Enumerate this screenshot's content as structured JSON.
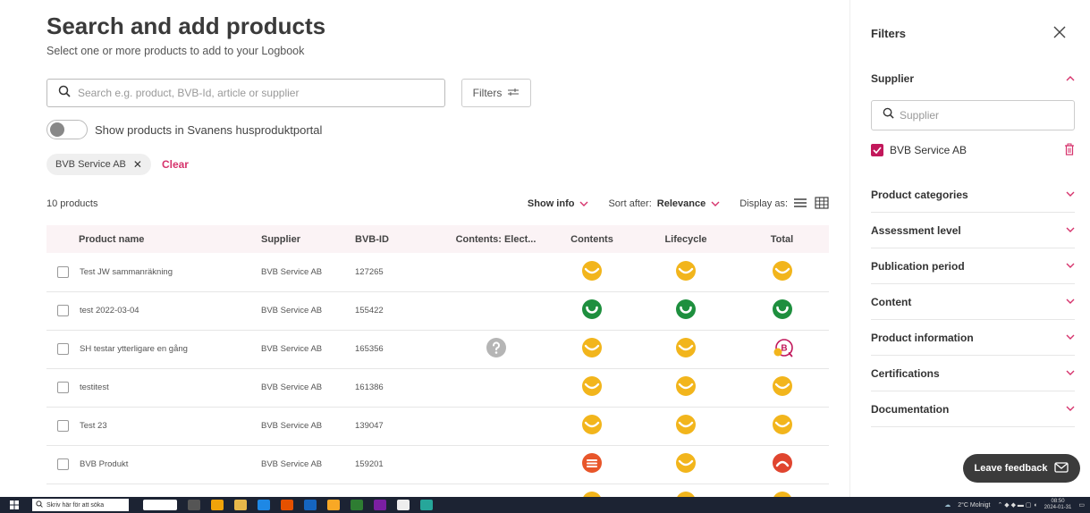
{
  "header": {
    "title": "Search and add products",
    "subtitle": "Select one or more products to add to your Logbook"
  },
  "search": {
    "placeholder": "Search e.g. product, BVB-Id, article or supplier",
    "value": ""
  },
  "filters_button": {
    "label": "Filters"
  },
  "toggle": {
    "label": "Show products in Svanens husproduktportal",
    "on": false
  },
  "chips": [
    {
      "label": "BVB Service AB"
    }
  ],
  "clear_label": "Clear",
  "list_header": {
    "count": "10 products",
    "show_info": "Show info",
    "sort_prefix": "Sort after:",
    "sort_value": "Relevance",
    "display_as": "Display as:"
  },
  "table": {
    "columns": [
      "Product name",
      "Supplier",
      "BVB-ID",
      "Contents: Elect...",
      "Contents",
      "Lifecycle",
      "Total"
    ],
    "rows": [
      {
        "name": "Test JW sammanräkning",
        "supplier": "BVB Service AB",
        "id": "127265",
        "elec": "",
        "contents": "yellow",
        "lifecycle": "yellow",
        "total": "yellow"
      },
      {
        "name": "test 2022-03-04",
        "supplier": "BVB Service AB",
        "id": "155422",
        "elec": "",
        "contents": "green",
        "lifecycle": "green",
        "total": "green"
      },
      {
        "name": "SH testar ytterligare en gång",
        "supplier": "BVB Service AB",
        "id": "165356",
        "elec": "question",
        "contents": "yellow",
        "lifecycle": "yellow",
        "total": "bq"
      },
      {
        "name": "testitest",
        "supplier": "BVB Service AB",
        "id": "161386",
        "elec": "",
        "contents": "yellow",
        "lifecycle": "yellow",
        "total": "yellow"
      },
      {
        "name": "Test 23",
        "supplier": "BVB Service AB",
        "id": "139047",
        "elec": "",
        "contents": "yellow",
        "lifecycle": "yellow",
        "total": "yellow"
      },
      {
        "name": "BVB Produkt",
        "supplier": "BVB Service AB",
        "id": "159201",
        "elec": "",
        "contents": "orange-lines",
        "lifecycle": "yellow",
        "total": "red"
      },
      {
        "name": "",
        "supplier": "",
        "id": "",
        "elec": "",
        "contents": "yellow",
        "lifecycle": "yellow",
        "total": "yellow"
      }
    ]
  },
  "filters_panel": {
    "title": "Filters",
    "supplier_section": "Supplier",
    "supplier_search_placeholder": "Supplier",
    "supplier_option": "BVB Service AB",
    "sections": [
      "Product categories",
      "Assessment level",
      "Publication period",
      "Content",
      "Product information",
      "Certifications",
      "Documentation"
    ]
  },
  "feedback": {
    "label": "Leave feedback"
  },
  "taskbar": {
    "search_placeholder": "Skriv här för att söka",
    "weather": "2°C Molnigt",
    "time": "08:50",
    "date": "2024-01-31"
  },
  "colors": {
    "accent": "#d6336c",
    "yellow": "#f2b51c",
    "green": "#1e8f3e",
    "orange": "#e8562a",
    "red": "#e0452f",
    "question": "#b5b5b5"
  },
  "icons": {
    "search": "search-icon",
    "filters": "sliders-icon",
    "close": "close-icon",
    "chevron_down": "chevron-down-icon",
    "chevron_up": "chevron-up-icon",
    "list_view": "list-view-icon",
    "grid_view": "grid-view-icon",
    "trash": "trash-icon",
    "mail": "mail-icon"
  }
}
